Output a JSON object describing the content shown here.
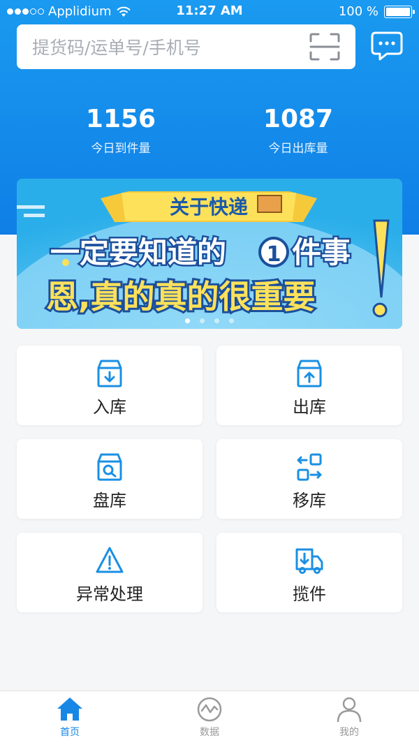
{
  "status_bar": {
    "carrier": "Applidium",
    "time": "11:27 AM",
    "battery": "100 %"
  },
  "search": {
    "placeholder": "提货码/运单号/手机号",
    "scan_icon": "scan-icon",
    "message_icon": "chat-bubble-icon"
  },
  "stats": [
    {
      "value": "1156",
      "label": "今日到件量"
    },
    {
      "value": "1087",
      "label": "今日出库量"
    }
  ],
  "banner": {
    "tag": "关于快递",
    "line1": "一定要知道的",
    "line1_num": "1",
    "line1_end": "件事",
    "line2": "恩,真的真的很重要",
    "slide_count": 4,
    "active_slide": 1
  },
  "actions": [
    {
      "label": "入库",
      "icon": "box-in-icon"
    },
    {
      "label": "出库",
      "icon": "box-out-icon"
    },
    {
      "label": "盘库",
      "icon": "box-search-icon"
    },
    {
      "label": "移库",
      "icon": "transfer-icon"
    },
    {
      "label": "异常处理",
      "icon": "warning-icon"
    },
    {
      "label": "揽件",
      "icon": "truck-icon"
    }
  ],
  "tabbar": [
    {
      "label": "首页",
      "icon": "home-icon",
      "active": true
    },
    {
      "label": "数据",
      "icon": "chart-icon",
      "active": false
    },
    {
      "label": "我的",
      "icon": "user-icon",
      "active": false
    }
  ],
  "colors": {
    "primary": "#1787e6",
    "hero_top": "#1a9af0",
    "hero_bottom": "#0f7fe6",
    "icon_blue": "#1a8fe3",
    "background": "#f5f6f8"
  }
}
